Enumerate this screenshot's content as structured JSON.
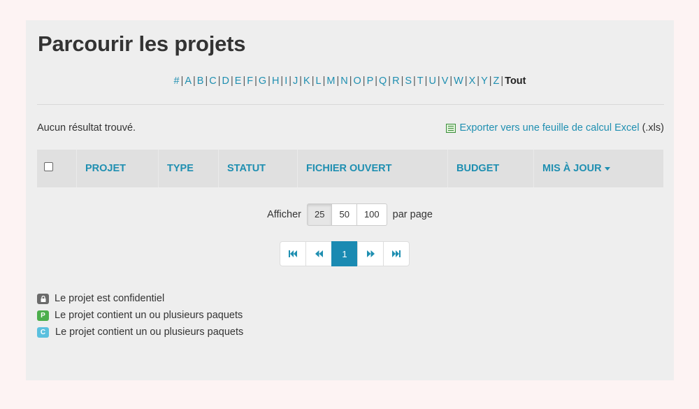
{
  "page": {
    "title": "Parcourir les projets"
  },
  "alphabet": {
    "letters": [
      "#",
      "A",
      "B",
      "C",
      "D",
      "E",
      "F",
      "G",
      "H",
      "I",
      "J",
      "K",
      "L",
      "M",
      "N",
      "O",
      "P",
      "Q",
      "R",
      "S",
      "T",
      "U",
      "V",
      "W",
      "X",
      "Y",
      "Z"
    ],
    "active": "Tout"
  },
  "results": {
    "empty_message": "Aucun résultat trouvé.",
    "export_link": "Exporter vers une feuille de calcul Excel",
    "export_suffix": "(.xls)"
  },
  "table": {
    "columns": [
      "PROJET",
      "TYPE",
      "STATUT",
      "FICHIER OUVERT",
      "BUDGET",
      "MIS À JOUR"
    ]
  },
  "per_page": {
    "prefix": "Afficher",
    "options": [
      "25",
      "50",
      "100"
    ],
    "selected": "25",
    "suffix": "par page"
  },
  "pagination": {
    "current": "1"
  },
  "legend": {
    "items": [
      {
        "badge": "lock-icon",
        "text": "Le projet est confidentiel"
      },
      {
        "badge": "P",
        "text": "Le projet contient un ou plusieurs paquets"
      },
      {
        "badge": "C",
        "text": "Le projet contient un ou plusieurs paquets"
      }
    ]
  },
  "colors": {
    "link": "#1f8fb1",
    "panel": "#eeeeee",
    "pager_active": "#1a8ab2",
    "badge_p": "#4cae4c",
    "badge_c": "#5bc0de"
  }
}
